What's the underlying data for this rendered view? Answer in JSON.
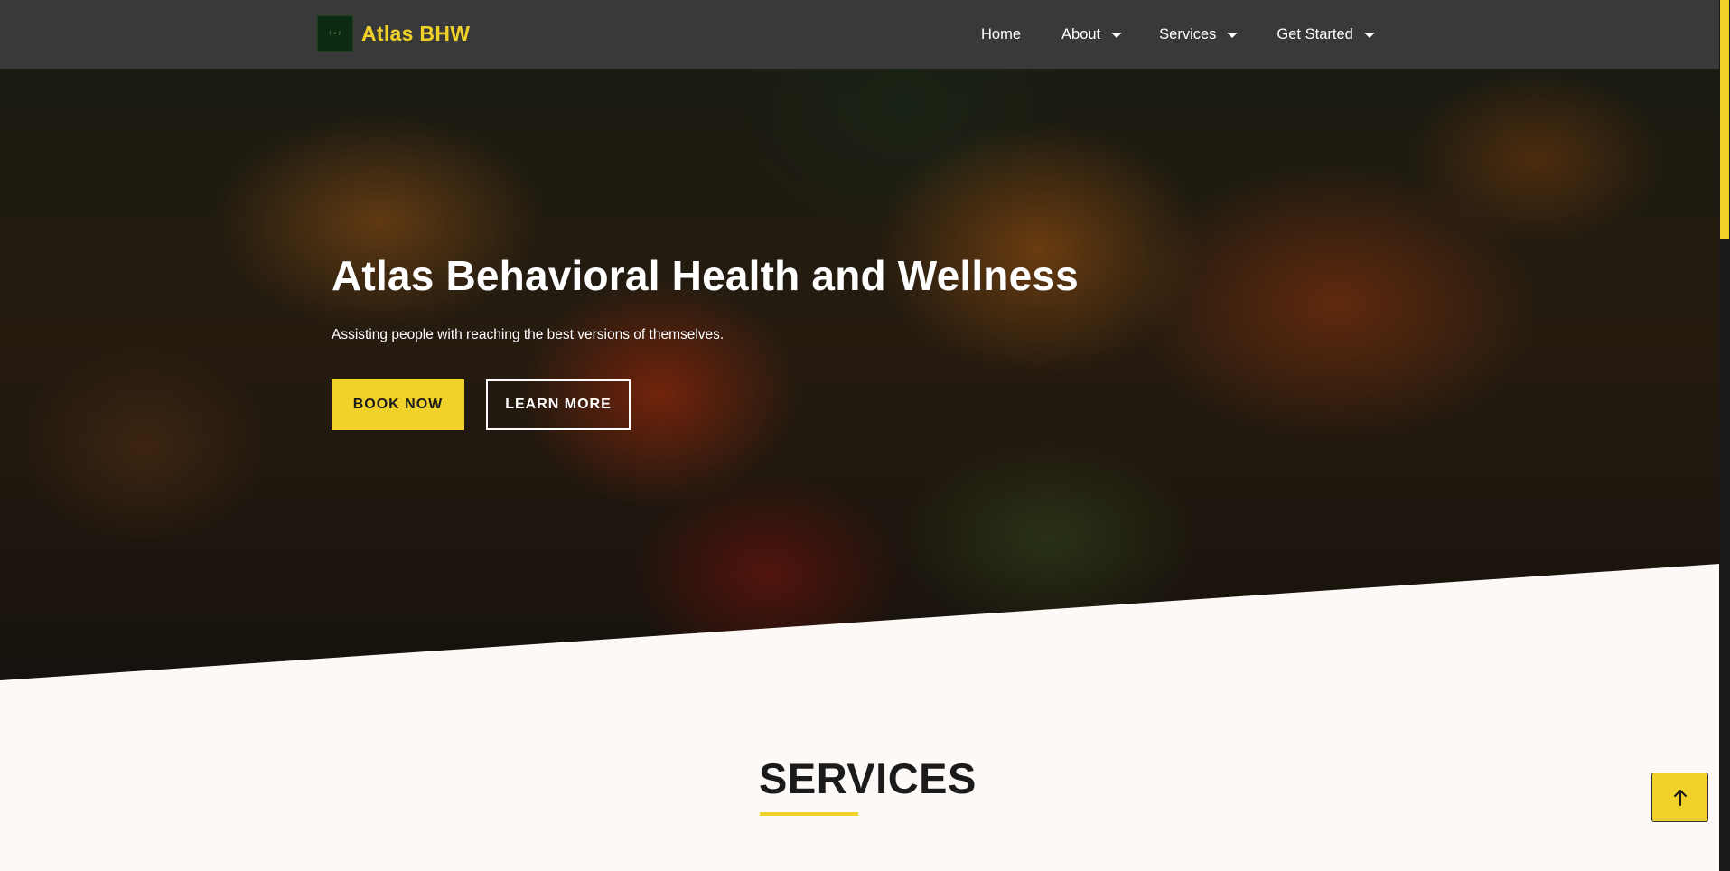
{
  "navbar": {
    "brand_name": "Atlas BHW",
    "logo_text": "ᚨ • ᚨ",
    "items": [
      {
        "label": "Home"
      },
      {
        "label": "About"
      },
      {
        "label": "Services"
      },
      {
        "label": "Get Started"
      }
    ]
  },
  "hero": {
    "title": "Atlas Behavioral Health and Wellness",
    "subtitle": "Assisting people with reaching the best versions of themselves.",
    "primary_button": "BOOK NOW",
    "secondary_button": "LEARN MORE"
  },
  "services": {
    "title": "SERVICES"
  },
  "back_to_top": {
    "icon": "arrow-up-icon"
  },
  "colors": {
    "accent": "#f0d22a",
    "navbar_bg": "#393939",
    "page_bg": "#fdf9f7",
    "text_dark": "#1b1b1b"
  }
}
